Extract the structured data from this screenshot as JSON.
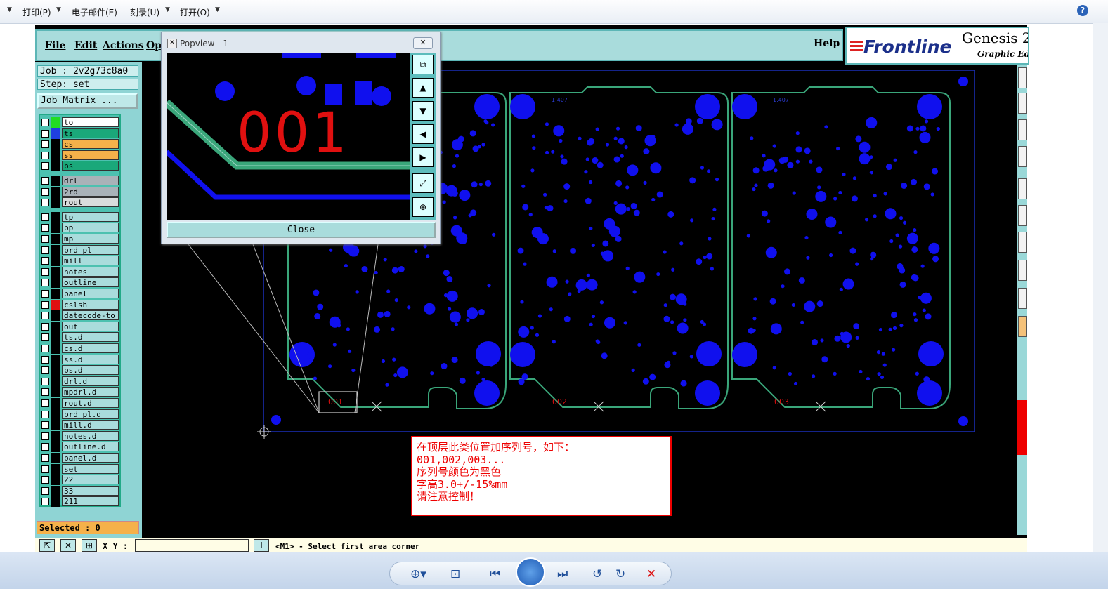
{
  "toolbar": {
    "print": "打印(P)",
    "email": "电子邮件(E)",
    "burn": "刻录(U)",
    "open": "打开(O)",
    "help_icon": "?"
  },
  "menu": {
    "file": "File",
    "edit": "Edit",
    "actions": "Actions",
    "options": "Opt",
    "help": "Help"
  },
  "logo": {
    "brand": "Frontline",
    "product": "Genesis 2",
    "subtitle": "Graphic Edi"
  },
  "panel": {
    "job": "Job : 2v2g73c8a0",
    "step": "Step: set",
    "job_matrix": "Job Matrix ...",
    "selected": "Selected : 0"
  },
  "layers": [
    {
      "name": "to",
      "color": "#ffffff",
      "swatch": "#22dd22"
    },
    {
      "name": "ts",
      "color": "#1aa87a",
      "swatch": "#1f3fe0"
    },
    {
      "name": "cs",
      "color": "#f5b14a",
      "swatch": "#000000"
    },
    {
      "name": "ss",
      "color": "#f5b14a",
      "swatch": "#000000"
    },
    {
      "name": "bs",
      "color": "#1aa87a",
      "swatch": "#000000"
    },
    {
      "name": "drl",
      "color": "#a9b2b8",
      "swatch": "#000000"
    },
    {
      "name": "2rd",
      "color": "#a9b2b8",
      "swatch": "#000000"
    },
    {
      "name": "rout",
      "color": "#d9dcdc",
      "swatch": "#000000"
    },
    {
      "name": "tp",
      "color": "#a9dcdc",
      "swatch": "#000000"
    },
    {
      "name": "bp",
      "color": "#a9dcdc",
      "swatch": "#000000"
    },
    {
      "name": "mp",
      "color": "#a9dcdc",
      "swatch": "#000000"
    },
    {
      "name": "brd_pl",
      "color": "#a9dcdc",
      "swatch": "#000000"
    },
    {
      "name": "mill",
      "color": "#a9dcdc",
      "swatch": "#000000"
    },
    {
      "name": "notes",
      "color": "#a9dcdc",
      "swatch": "#000000"
    },
    {
      "name": "outline",
      "color": "#a9dcdc",
      "swatch": "#000000"
    },
    {
      "name": "panel",
      "color": "#a9dcdc",
      "swatch": "#000000"
    },
    {
      "name": "cslsh",
      "color": "#a9dcdc",
      "swatch": "#e01010"
    },
    {
      "name": "datecode-to",
      "color": "#a9dcdc",
      "swatch": "#000000"
    },
    {
      "name": "out",
      "color": "#a9dcdc",
      "swatch": "#000000"
    },
    {
      "name": "ts.d",
      "color": "#a9dcdc",
      "swatch": "#000000"
    },
    {
      "name": "cs.d",
      "color": "#a9dcdc",
      "swatch": "#000000"
    },
    {
      "name": "ss.d",
      "color": "#a9dcdc",
      "swatch": "#000000"
    },
    {
      "name": "bs.d",
      "color": "#a9dcdc",
      "swatch": "#000000"
    },
    {
      "name": "drl.d",
      "color": "#a9dcdc",
      "swatch": "#000000"
    },
    {
      "name": "mpdrl.d",
      "color": "#a9dcdc",
      "swatch": "#000000"
    },
    {
      "name": "rout.d",
      "color": "#a9dcdc",
      "swatch": "#000000"
    },
    {
      "name": "brd_pl.d",
      "color": "#a9dcdc",
      "swatch": "#000000"
    },
    {
      "name": "mill.d",
      "color": "#a9dcdc",
      "swatch": "#000000"
    },
    {
      "name": "notes.d",
      "color": "#a9dcdc",
      "swatch": "#000000"
    },
    {
      "name": "outline.d",
      "color": "#a9dcdc",
      "swatch": "#000000"
    },
    {
      "name": "panel.d",
      "color": "#a9dcdc",
      "swatch": "#000000"
    },
    {
      "name": "set",
      "color": "#a9dcdc",
      "swatch": "#000000"
    },
    {
      "name": "22",
      "color": "#a9dcdc",
      "swatch": "#000000"
    },
    {
      "name": "33",
      "color": "#a9dcdc",
      "swatch": "#000000"
    },
    {
      "name": "211",
      "color": "#a9dcdc",
      "swatch": "#000000"
    }
  ],
  "status": {
    "xy_label": "X Y :",
    "xy_value": "",
    "prompt": "<M1> - Select first area corner"
  },
  "popview": {
    "title": "Popview - 1",
    "serial": "001",
    "close": "Close"
  },
  "board": {
    "serials": [
      "001",
      "002",
      "003"
    ],
    "dimension_label": "1.407"
  },
  "note": {
    "lines": [
      "在顶层此类位置加序列号，如下：",
      "001,002,003...",
      "序列号颜色为黑色",
      "字高3.0+/-15%mm",
      "请注意控制！"
    ]
  },
  "colors": {
    "pad_blue": "#1010ee",
    "outline_green": "#3aa67a",
    "serial_red": "#e01010",
    "panel_teal": "#a9dcdc"
  }
}
